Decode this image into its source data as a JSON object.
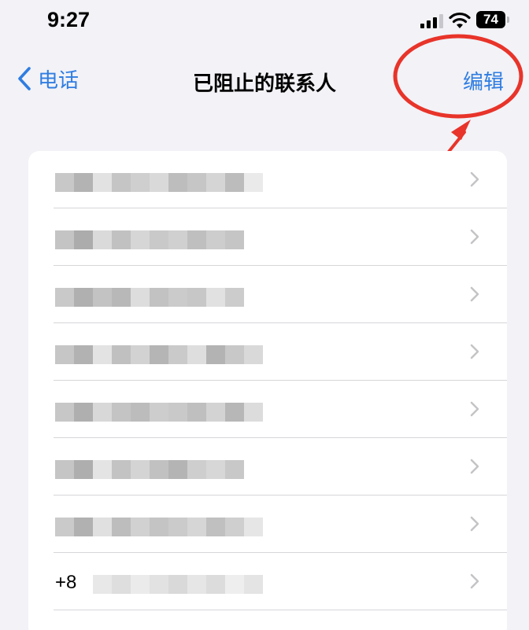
{
  "status_bar": {
    "time": "9:27",
    "battery": "74"
  },
  "nav": {
    "back_label": "电话",
    "title": "已阻止的联系人",
    "edit_label": "编辑"
  },
  "contacts": [
    {
      "label": ""
    },
    {
      "label": ""
    },
    {
      "label": ""
    },
    {
      "label": ""
    },
    {
      "label": ""
    },
    {
      "label": ""
    },
    {
      "label": ""
    },
    {
      "label": "+8"
    }
  ],
  "colors": {
    "accent": "#2f7de1",
    "background": "#f2f2f7",
    "annotation": "#e8342a"
  },
  "icons": [
    "signal-icon",
    "wifi-icon",
    "battery-icon",
    "chevron-left-icon",
    "chevron-right-icon"
  ]
}
